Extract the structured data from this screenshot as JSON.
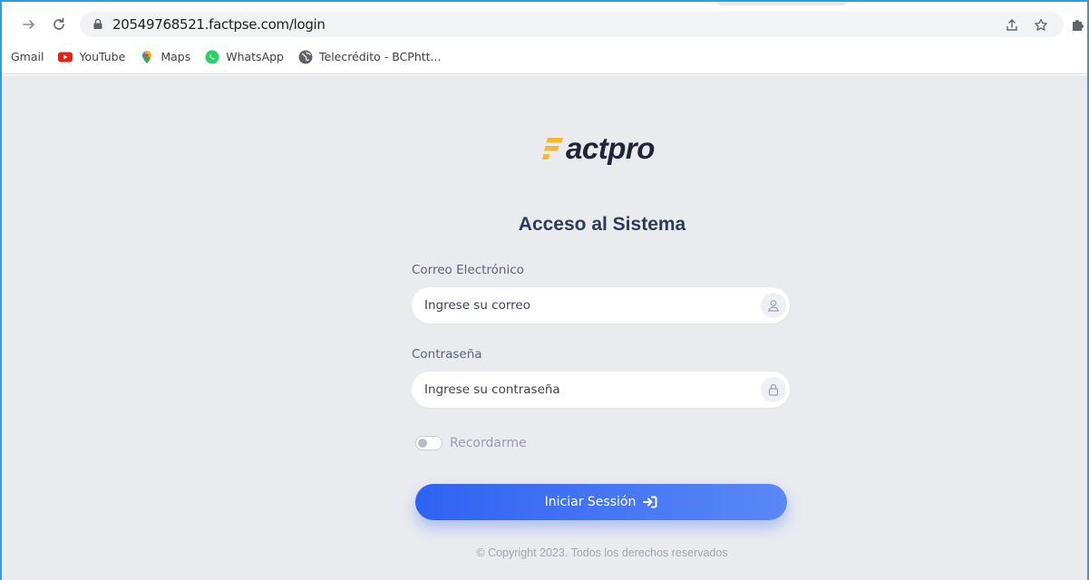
{
  "browser": {
    "url": "20549768521.factpse.com/login",
    "bookmarks": [
      {
        "label": "Gmail",
        "icon": "gmail-icon"
      },
      {
        "label": "YouTube",
        "icon": "youtube-icon"
      },
      {
        "label": "Maps",
        "icon": "maps-icon"
      },
      {
        "label": "WhatsApp",
        "icon": "whatsapp-icon"
      },
      {
        "label": "Telecrédito - BCPhtt...",
        "icon": "globe-icon"
      }
    ]
  },
  "logo": {
    "text": "actpro",
    "accent_color": "#f5b82e"
  },
  "login": {
    "title": "Acceso al Sistema",
    "email_label": "Correo Electrónico",
    "email_placeholder": "Ingrese su correo",
    "email_icon": "user-icon",
    "password_label": "Contraseña",
    "password_placeholder": "Ingrese su contraseña",
    "password_icon": "lock-icon",
    "remember_label": "Recordarme",
    "remember_checked": false,
    "submit_label": "Iniciar Sessión",
    "submit_icon": "sign-in-icon",
    "button_color": "#3a6cf2"
  },
  "footer": {
    "copyright": "© Copyright 2023. Todos los derechos reservados"
  }
}
